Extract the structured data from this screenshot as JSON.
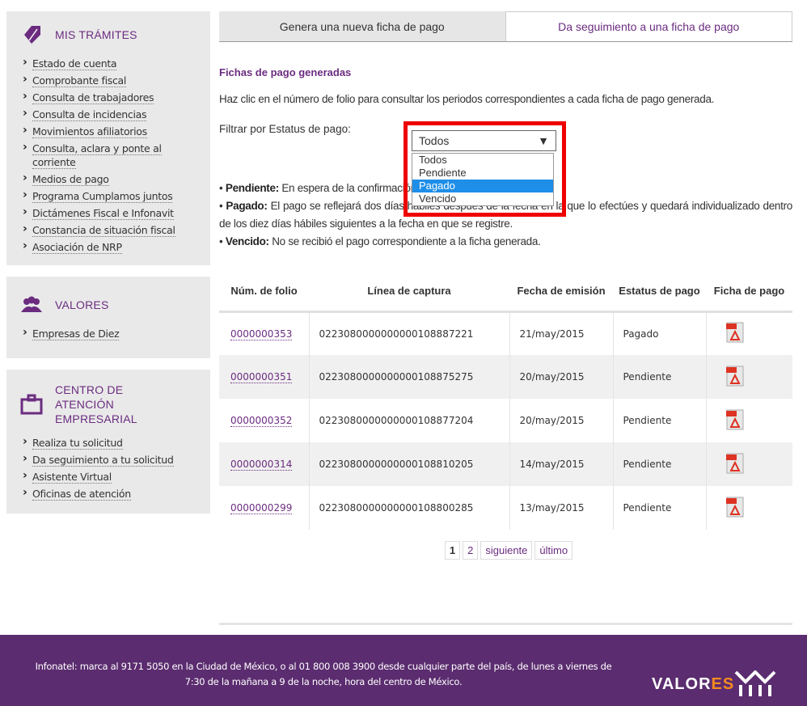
{
  "sidebar": {
    "sections": [
      {
        "title": "MIS TRÁMITES",
        "icon": "tag-icon",
        "items": [
          "Estado de cuenta",
          "Comprobante fiscal",
          "Consulta de trabajadores",
          "Consulta de incidencias",
          "Movimientos afiliatorios",
          "Consulta, aclara y ponte al corriente",
          "Medios de pago",
          "Programa Cumplamos juntos",
          "Dictámenes Fiscal e Infonavit",
          "Constancia de situación fiscal",
          "Asociación de NRP"
        ]
      },
      {
        "title": "VALORES",
        "icon": "people-icon",
        "items": [
          "Empresas de Diez"
        ]
      },
      {
        "title": "CENTRO DE ATENCIÓN EMPRESARIAL",
        "icon": "briefcase-icon",
        "items": [
          "Realiza tu solicitud",
          "Da seguimiento a tu solicitud",
          "Asistente Virtual",
          "Oficinas de atención"
        ]
      }
    ]
  },
  "tabs": [
    "Genera una nueva ficha de pago",
    "Da seguimiento a una ficha de pago"
  ],
  "main": {
    "section_title": "Fichas de pago generadas",
    "intro": "Haz clic en el número de folio para consultar los periodos correspondientes a cada ficha de pago generada.",
    "filter_label": "Filtrar por Estatus de pago:",
    "select_value": "Todos",
    "options": [
      "Todos",
      "Pendiente",
      "Pagado",
      "Vencido"
    ],
    "legend": [
      {
        "term": "Pendiente:",
        "text": " En espera de la confirmación de pago por parte del banco."
      },
      {
        "term": "Pagado:",
        "text": " El pago se reflejará dos días hábiles después de la fecha en la que lo efectúes y quedará individualizado dentro de los diez días hábiles siguientes a la fecha en que se registre."
      },
      {
        "term": "Vencido:",
        "text": " No se recibió el pago correspondiente a la ficha generada."
      }
    ]
  },
  "table": {
    "headers": [
      "Núm. de folio",
      "Línea de captura",
      "Fecha de emisión",
      "Estatus de pago",
      "Ficha de pago"
    ],
    "rows": [
      {
        "folio": "0000000353",
        "linea": "0223080000000000108887221",
        "fecha": "21/may/2015",
        "estatus": "Pagado"
      },
      {
        "folio": "0000000351",
        "linea": "0223080000000000108875275",
        "fecha": "20/may/2015",
        "estatus": "Pendiente"
      },
      {
        "folio": "0000000352",
        "linea": "0223080000000000108877204",
        "fecha": "20/may/2015",
        "estatus": "Pendiente"
      },
      {
        "folio": "0000000314",
        "linea": "0223080000000000108810205",
        "fecha": "14/may/2015",
        "estatus": "Pendiente"
      },
      {
        "folio": "0000000299",
        "linea": "0223080000000000108800285",
        "fecha": "13/may/2015",
        "estatus": "Pendiente"
      }
    ]
  },
  "pager": [
    "1",
    "2",
    "siguiente",
    "último"
  ],
  "footer": {
    "text": "Infonatel: marca al 9171 5050 en la Ciudad de México, o al 01 800 008 3900 desde cualquier parte del país, de lunes a viernes de 7:30 de la mañana a 9 de la noche, hora del centro de México.",
    "logo_a": "VALOR",
    "logo_b": "ES"
  },
  "colors": {
    "accent": "#6b2c80",
    "footer": "#5b2c6f",
    "highlight": "#ee0000",
    "selected": "#1e8ee8"
  }
}
